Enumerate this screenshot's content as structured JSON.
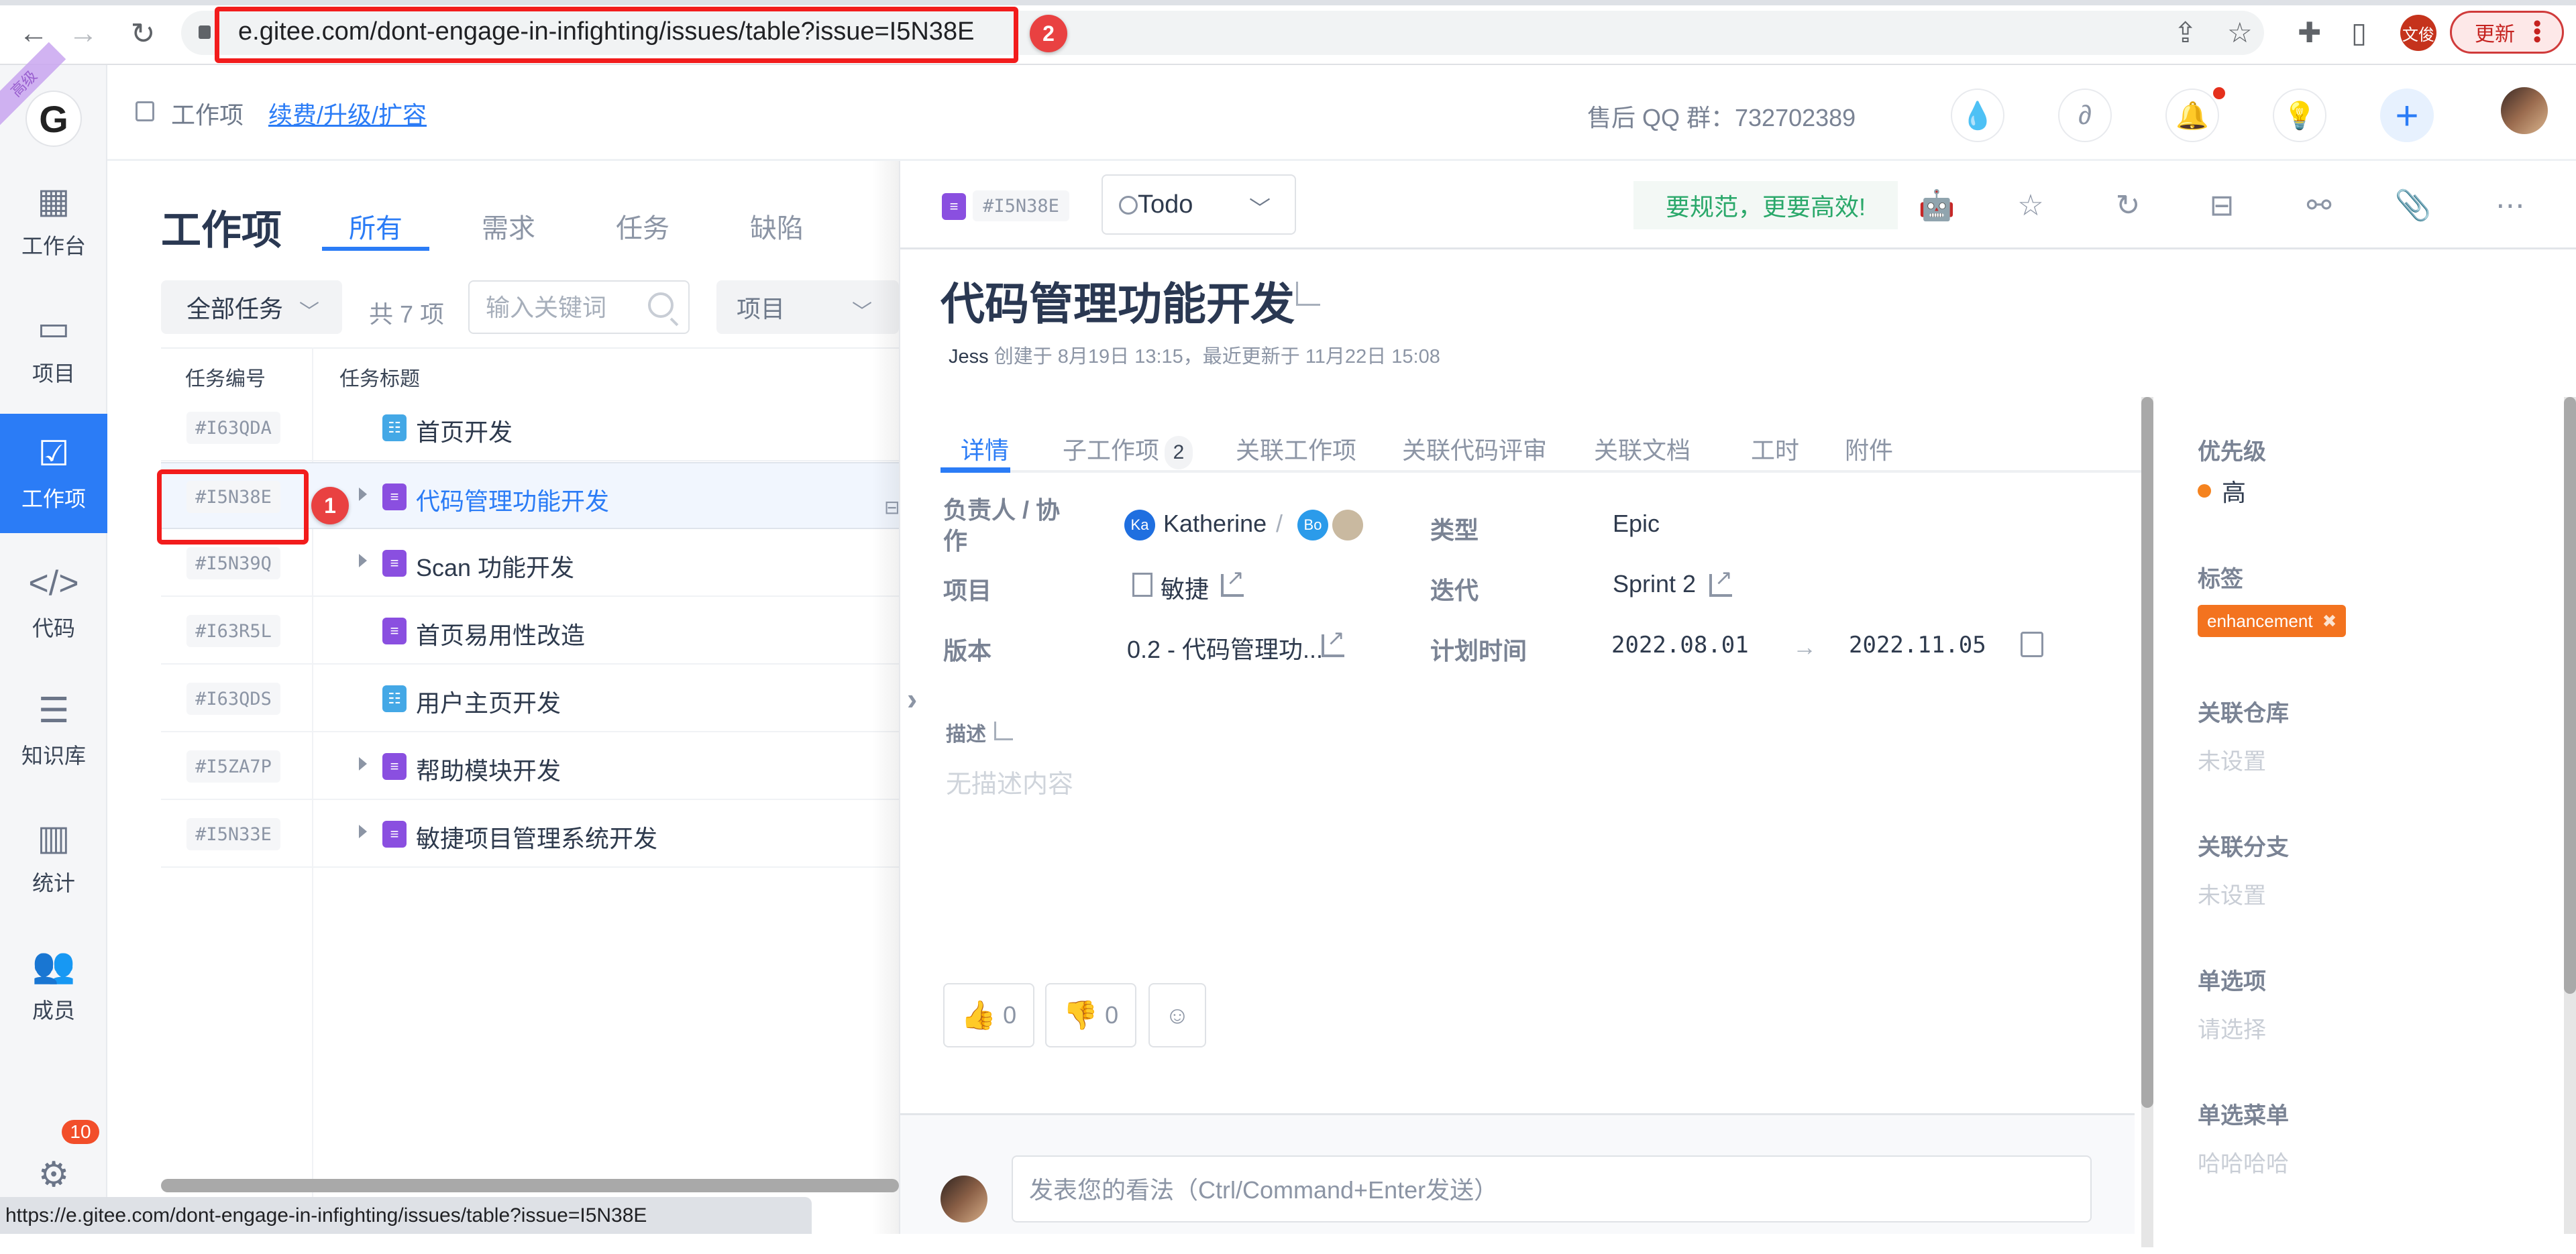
{
  "browser": {
    "url": "e.gitee.com/dont-engage-in-infighting/issues/table?issue=I5N38E",
    "url_annotation": "2",
    "profile_initials": "文俊",
    "update_label": "更新",
    "status_bar_url": "https://e.gitee.com/dont-engage-in-infighting/issues/table?issue=I5N38E"
  },
  "sidebar": {
    "logo": "G",
    "ribbon": "高级",
    "items": [
      {
        "label": "工作台",
        "icon": "dashboard-icon",
        "active": false
      },
      {
        "label": "项目",
        "icon": "project-book-icon",
        "active": false
      },
      {
        "label": "工作项",
        "icon": "workitem-checklist-icon",
        "active": true
      },
      {
        "label": "代码",
        "icon": "code-icon",
        "active": false
      },
      {
        "label": "知识库",
        "icon": "knowledge-base-icon",
        "active": false
      },
      {
        "label": "统计",
        "icon": "chart-bar-icon",
        "active": false
      },
      {
        "label": "成员",
        "icon": "members-icon",
        "active": false
      },
      {
        "label": "设置",
        "icon": "gear-icon",
        "active": false
      }
    ],
    "settings_badge": "10"
  },
  "header": {
    "breadcrumb_current": "工作项",
    "breadcrumb_link": "续费/升级/扩容",
    "qq_group": "售后 QQ 群：732702389"
  },
  "list": {
    "title": "工作项",
    "tabs": [
      "所有",
      "需求",
      "任务",
      "缺陷"
    ],
    "active_tab": 0,
    "filter_all": "全部任务",
    "count": "共 7 项",
    "search_placeholder": "输入关键词",
    "filter_project": "项目",
    "columns": [
      "任务编号",
      "任务标题"
    ],
    "rows": [
      {
        "id": "#I63QDA",
        "title": "首页开发",
        "type": "task",
        "expandable": false,
        "selected": false
      },
      {
        "id": "#I5N38E",
        "title": "代码管理功能开发",
        "type": "epic",
        "expandable": true,
        "selected": true
      },
      {
        "id": "#I5N39Q",
        "title": "Scan 功能开发",
        "type": "epic",
        "expandable": true,
        "selected": false
      },
      {
        "id": "#I63R5L",
        "title": "首页易用性改造",
        "type": "epic",
        "expandable": false,
        "selected": false
      },
      {
        "id": "#I63QDS",
        "title": "用户主页开发",
        "type": "task",
        "expandable": false,
        "selected": false
      },
      {
        "id": "#I5ZA7P",
        "title": "帮助模块开发",
        "type": "epic",
        "expandable": true,
        "selected": false
      },
      {
        "id": "#I5N33E",
        "title": "敏捷项目管理系统开发",
        "type": "epic",
        "expandable": true,
        "selected": false
      }
    ],
    "row_annotation": "1"
  },
  "detail": {
    "id": "#I5N38E",
    "status": "Todo",
    "slogan": "要规范，更要高效!",
    "title": "代码管理功能开发",
    "author": "Jess",
    "meta": "创建于 8月19日 13:15，最近更新于 11月22日 15:08",
    "tabs": [
      {
        "label": "详情",
        "count": null
      },
      {
        "label": "子工作项",
        "count": "2"
      },
      {
        "label": "关联工作项",
        "count": null
      },
      {
        "label": "关联代码评审",
        "count": null
      },
      {
        "label": "关联文档",
        "count": null
      },
      {
        "label": "工时",
        "count": null
      },
      {
        "label": "附件",
        "count": null
      }
    ],
    "fields": {
      "assignee_label": "负责人 / 协作",
      "assignee_initials": "Ka",
      "assignee_name": "Katherine",
      "separator": "/",
      "collab_initials": "Bo",
      "type_label": "类型",
      "type_value": "Epic",
      "project_label": "项目",
      "project_value": "敏捷",
      "iteration_label": "迭代",
      "iteration_value": "Sprint 2",
      "version_label": "版本",
      "version_value": "0.2 - 代码管理功...",
      "plan_label": "计划时间",
      "plan_start": "2022.08.01",
      "plan_arrow": "→",
      "plan_end": "2022.11.05"
    },
    "description_label": "描述",
    "description_empty": "无描述内容",
    "reactions": {
      "thumbs_up": "0",
      "thumbs_down": "0"
    },
    "comment_placeholder": "发表您的看法（Ctrl/Command+Enter发送）"
  },
  "props": {
    "priority_label": "优先级",
    "priority_value": "高",
    "priority_color": "#f5831f",
    "tags_label": "标签",
    "tag": "enhancement",
    "tag_color": "#f3731f",
    "repo_label": "关联仓库",
    "repo_value": "未设置",
    "branch_label": "关联分支",
    "branch_value": "未设置",
    "single_label": "单选项",
    "single_value": "请选择",
    "menu_label": "单选菜单",
    "menu_value": "哈哈哈哈"
  }
}
